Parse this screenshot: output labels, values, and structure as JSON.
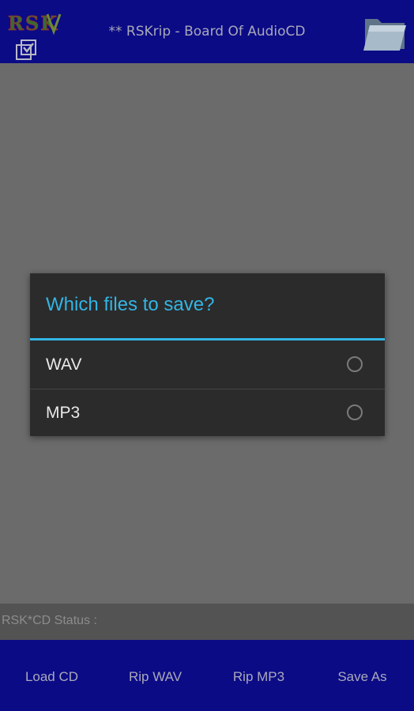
{
  "header": {
    "logo_text": "RSK",
    "title": "** RSKrip - Board Of AudioCD",
    "folder_icon": "folder-icon",
    "check_icon": "checkbox-icon"
  },
  "dialog": {
    "title": "Which files to save?",
    "options": [
      {
        "label": "WAV",
        "selected": false
      },
      {
        "label": "MP3",
        "selected": false
      }
    ]
  },
  "status": {
    "label": "RSK*CD Status :"
  },
  "footer": {
    "buttons": [
      "Load CD",
      "Rip WAV",
      "Rip MP3",
      "Save As"
    ]
  },
  "colors": {
    "bar_blue": "#0b0b86",
    "accent": "#33b5e5",
    "dialog_bg": "#2b2b2b",
    "overlay_gray": "#6b6b6b"
  }
}
